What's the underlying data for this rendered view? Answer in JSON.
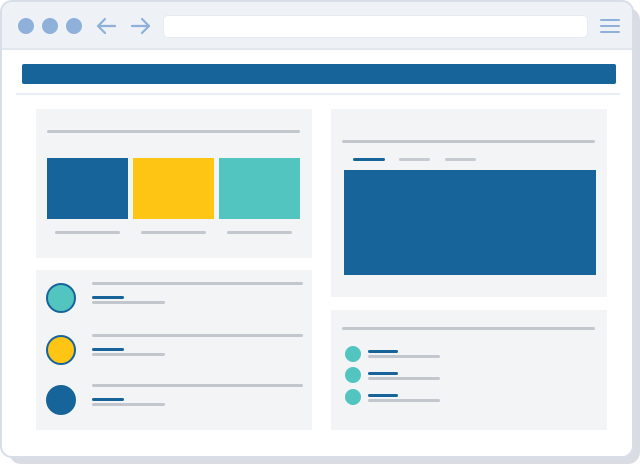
{
  "app": {
    "window_title": "",
    "url": "",
    "header_text": ""
  },
  "colors": {
    "primary": "#17649b",
    "accent_yellow": "#ffc515",
    "accent_teal": "#52c5c0",
    "panel_bg": "#f3f4f6",
    "window_bar": "#eef1f5",
    "control_blue": "#8eb0d9"
  },
  "icons": {
    "window_controls": [
      "window-dot-icon",
      "window-dot-icon",
      "window-dot-icon"
    ],
    "back": "arrow-left-icon",
    "forward": "arrow-right-icon",
    "menu": "hamburger-menu-icon"
  },
  "cards": {
    "gallery": {
      "title": "",
      "tiles": [
        {
          "caption": "",
          "color": "#17649b"
        },
        {
          "caption": "",
          "color": "#ffc515"
        },
        {
          "caption": "",
          "color": "#52c5c0"
        }
      ]
    },
    "media": {
      "title": "",
      "tabs": [
        "",
        "",
        ""
      ]
    },
    "profiles": [
      {
        "name": "",
        "subtitle": "",
        "color": "#52c5c0"
      },
      {
        "name": "",
        "subtitle": "",
        "color": "#ffc515"
      },
      {
        "name": "",
        "subtitle": "",
        "color": "#17649b"
      }
    ],
    "mini_list": {
      "title": "",
      "items": [
        "",
        "",
        ""
      ]
    }
  }
}
